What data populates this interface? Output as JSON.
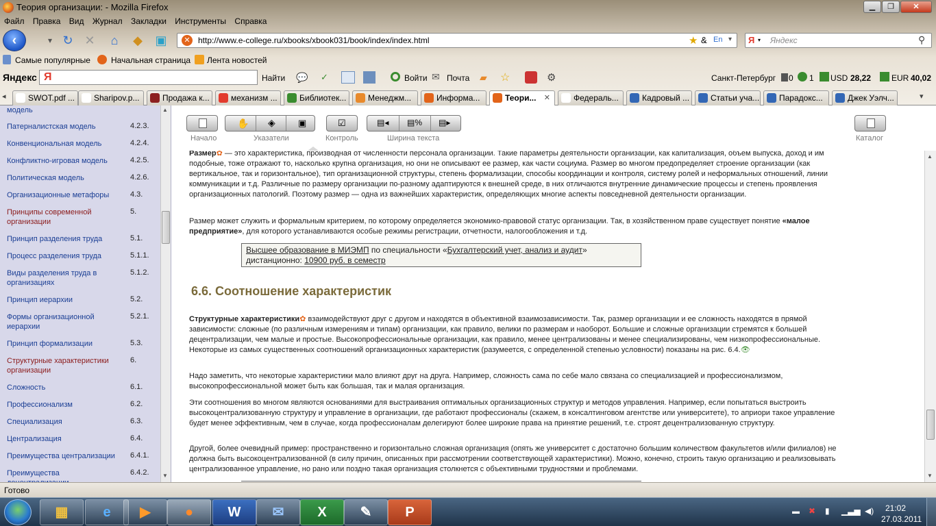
{
  "window": {
    "title": "Теория организации: - Mozilla Firefox",
    "buttons": {
      "minimize": "▁",
      "restore": "❐",
      "close": "✕"
    }
  },
  "menu": [
    "Файл",
    "Правка",
    "Вид",
    "Журнал",
    "Закладки",
    "Инструменты",
    "Справка"
  ],
  "nav": {
    "url": "http://www.e-college.ru/xbooks/xbook031/book/index/index.html",
    "search_placeholder": "Яндекс"
  },
  "bookmarks": [
    "Самые популярные",
    "Начальная страница",
    "Лента новостей"
  ],
  "yandex_bar": {
    "logo": "Яндекс",
    "find": "Найти",
    "login": "Войти",
    "mail": "Почта",
    "city": "Санкт-Петербург",
    "badge1": "0",
    "badge2": "1",
    "usd_label": "USD",
    "usd": "28,22",
    "eur_label": "EUR",
    "eur": "40,02"
  },
  "tabs": [
    {
      "label": "SWOT.pdf ...",
      "color": "#ffffff"
    },
    {
      "label": "Sharipov.p...",
      "color": "#ffffff"
    },
    {
      "label": "Продажа к...",
      "color": "#8c1f1f"
    },
    {
      "label": "механизм ...",
      "color": "#e23b2e"
    },
    {
      "label": "Библиотек...",
      "color": "#3a8c2f"
    },
    {
      "label": "Менеджм...",
      "color": "#e88a2c"
    },
    {
      "label": "Информа...",
      "color": "#e2641a"
    },
    {
      "label": "Теори...",
      "color": "#e2641a"
    },
    {
      "label": "Федераль...",
      "color": "#ffffff"
    },
    {
      "label": "Кадровый ...",
      "color": "#3367b5"
    },
    {
      "label": "Статьи уча...",
      "color": "#3367b5"
    },
    {
      "label": "Парадокс...",
      "color": "#3367b5"
    },
    {
      "label": "Джек Уэлч...",
      "color": "#3367b5"
    }
  ],
  "sidebar": {
    "items": [
      {
        "label": "модель",
        "num": ""
      },
      {
        "label": "Патерналистская модель",
        "num": "4.2.3."
      },
      {
        "label": "Конвенциональная модель",
        "num": "4.2.4."
      },
      {
        "label": "Конфликтно-игровая модель",
        "num": "4.2.5."
      },
      {
        "label": "Политическая модель",
        "num": "4.2.6."
      },
      {
        "label": "Организационные метафоры",
        "num": "4.3."
      },
      {
        "label": "Принципы современной организации",
        "num": "5."
      },
      {
        "label": "Принцип разделения труда",
        "num": "5.1."
      },
      {
        "label": "Процесс разделения труда",
        "num": "5.1.1."
      },
      {
        "label": "Виды разделения труда в организациях",
        "num": "5.1.2."
      },
      {
        "label": "Принцип иерархии",
        "num": "5.2."
      },
      {
        "label": "Формы организационной иерархии",
        "num": "5.2.1."
      },
      {
        "label": "Принцип формализации",
        "num": "5.3."
      },
      {
        "label": "Структурные характеристики организации",
        "num": "6."
      },
      {
        "label": "Сложность",
        "num": "6.1."
      },
      {
        "label": "Профессионализм",
        "num": "6.2."
      },
      {
        "label": "Специализация",
        "num": "6.3."
      },
      {
        "label": "Централизация",
        "num": "6.4."
      },
      {
        "label": "Преимущества централизации",
        "num": "6.4.1."
      },
      {
        "label": "Преимущества децентрализации",
        "num": "6.4.2."
      }
    ]
  },
  "toolbar": {
    "start": "Начало",
    "pointers": "Указатели",
    "control": "Контроль",
    "width": "Ширина текста",
    "catalog": "Каталог"
  },
  "content": {
    "p1_lead": "Размер",
    "p1": "— это характеристика, производная от численности персонала организации. Такие параметры деятельности организации, как капитализация, объем выпуска, доход и им подобные, тоже отражают то, насколько крупна организация, но они не описывают ее размер, как части социума. Размер во многом предопределяет строение организации (как вертикальное, так и горизонтальное), тип организационной структуры, степень формализации, способы координации и контроля, систему ролей и неформальных отношений, линии коммуникации и т.д. Различные по размеру организации по-разному адаптируются к внешней среде, в них отличаются внутренние динамические процессы и степень проявления организационных патологий. Поэтому размер — одна из важнейших характеристик, определяющих многие аспекты повседневной деятельности организации.",
    "p2a": "Размер может служить и формальным критерием, по которому определяется экономико-правовой статус организации. Так, в хозяйственном праве существует понятие",
    "p2b": "«малое предприятие»",
    "p2c": ", для которого устанавливаются особые режимы регистрации, отчетности, налогообложения и т.д.",
    "ad_link1": "Высшее образование в МИЭМП",
    "ad_text1": "по специальности «",
    "ad_link2": "Бухгалтерский учет, анализ и аудит",
    "ad_text2": "»",
    "ad_text3": "дистанционно:",
    "ad_link3": "10900 руб. в семестр",
    "heading": "6.6. Соотношение характеристик",
    "p3_lead": "Структурные характеристики",
    "p3": "взаимодействуют друг с другом и находятся в объективной взаимозависимости. Так, размер организации и ее сложность находятся в прямой зависимости: сложные (по различным измерениям и типам) организации, как правило, велики по размерам и наоборот. Большие и сложные организации стремятся к большей децентрализации, чем малые и простые. Высокопрофессиональные организации, как правило, менее централизованы и менее специализированы, чем низкопрофессиональные. Некоторые из самых существенных соотношений организационных характеристик (разумеется, с определенной степенью условности) показаны на рис. 6.4.",
    "p4": "Надо заметить, что некоторые характеристики мало влияют друг на друга. Например, сложность сама по себе мало связана со специализацией и профессионализмом, высокопрофессиональной может быть как большая, так и малая организация.",
    "p5": "Эти соотношения во многом являются основаниями для выстраивания оптимальных организационных структур и методов управления. Например, если попытаться выстроить высокоцентрализованную структуру и управление в организации, где работают профессионалы (скажем, в консалтинговом агентстве или университете), то априори такое управление будет менее эффективным, чем в случае, когда профессионалам делегируют более широкие права на принятие решений, т.е. строят децентрализованную структуру.",
    "p6": "Другой, более очевидный пример: пространственно и горизонтально сложная организация (опять же университет с достаточно большим количеством факультетов и/или филиалов) не должна быть высокоцентрализованной (в силу причин, описанных при рассмотрении соответствующей характеристики). Можно, конечно, строить такую организацию и реализовывать централизованное управление, но рано или поздно такая организация столкнется с объективными трудностями и проблемами."
  },
  "status": "Готово",
  "taskbar": {
    "time": "21:02",
    "date": "27.03.2011",
    "apps": [
      "explorer",
      "ie",
      "media-player",
      "firefox",
      "word",
      "thunderbird",
      "excel",
      "pen",
      "powerpoint"
    ]
  }
}
